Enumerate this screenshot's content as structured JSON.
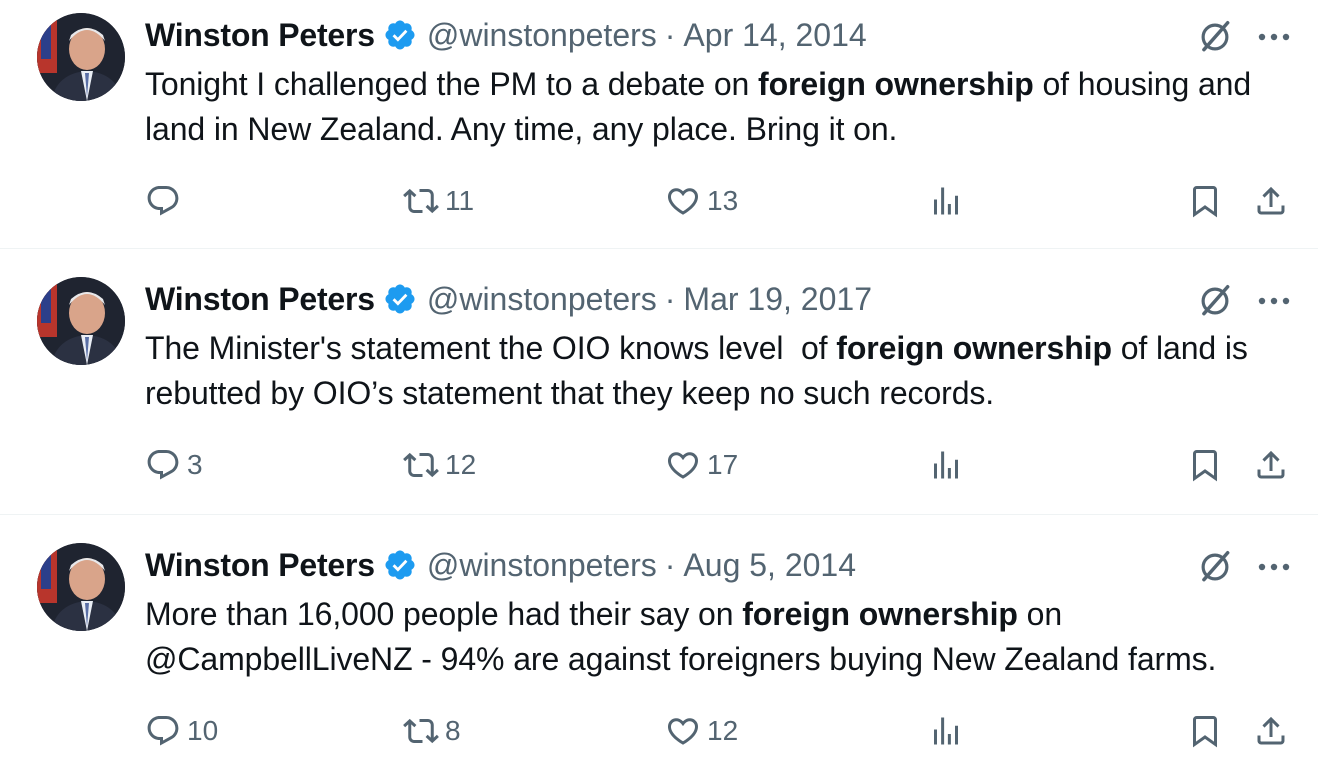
{
  "tweets": [
    {
      "name": "Winston Peters",
      "handle": "@winstonpeters",
      "separator": "·",
      "date": "Apr 14, 2014",
      "text_before": "Tonight I challenged the PM to a debate on ",
      "text_bold": "foreign ownership",
      "text_after": " of housing and land in New Zealand. Any time, any place. Bring it on.",
      "replies": "",
      "retweets": "11",
      "likes": "13"
    },
    {
      "name": "Winston Peters",
      "handle": "@winstonpeters",
      "separator": "·",
      "date": "Mar 19, 2017",
      "text_before": "The Minister's statement the OIO knows level  of ",
      "text_bold": "foreign ownership",
      "text_after": " of land is rebutted by OIO’s statement that they keep no such records.",
      "replies": "3",
      "retweets": "12",
      "likes": "17"
    },
    {
      "name": "Winston Peters",
      "handle": "@winstonpeters",
      "separator": "·",
      "date": "Aug 5, 2014",
      "text_before": "More than 16,000 people had their say on ",
      "text_bold": "foreign ownership",
      "text_after": " on @CampbellLiveNZ - 94% are against foreigners buying New Zealand farms.",
      "replies": "10",
      "retweets": "8",
      "likes": "12"
    }
  ],
  "icons": {
    "verified": "verified-badge-icon",
    "grok": "grok-icon",
    "more": "more-icon",
    "reply": "reply-icon",
    "retweet": "retweet-icon",
    "like": "heart-icon",
    "views": "views-icon",
    "bookmark": "bookmark-icon",
    "share": "share-icon"
  },
  "colors": {
    "text": "#0f1419",
    "secondary": "#536471",
    "verified": "#1d9bf0",
    "divider": "#eff3f4"
  }
}
